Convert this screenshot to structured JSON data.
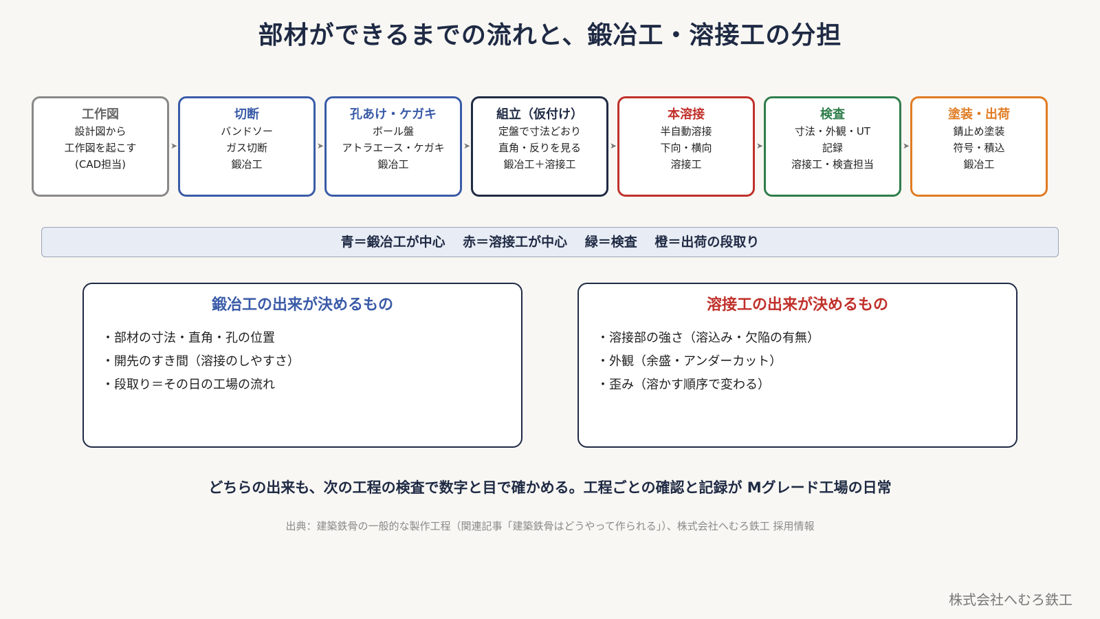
{
  "title": "部材ができるまでの流れと、鍛冶工・溶接工の分担",
  "steps": [
    {
      "title": "工作図",
      "lines": [
        "設計図から",
        "工作図を起こす",
        "(CAD担当)"
      ],
      "color": "#888888",
      "title_color": "#666666"
    },
    {
      "title": "切断",
      "lines": [
        "バンドソー",
        "ガス切断",
        "鍛冶工"
      ],
      "color": "#3a5ba8",
      "title_color": "#3a5ba8"
    },
    {
      "title": "孔あけ・ケガキ",
      "lines": [
        "ボール盤",
        "アトラエース・ケガキ",
        "鍛冶工"
      ],
      "color": "#3a5ba8",
      "title_color": "#3a5ba8"
    },
    {
      "title": "組立（仮付け）",
      "lines": [
        "定盤で寸法どおり",
        "直角・反りを見る",
        "鍛冶工＋溶接工"
      ],
      "color": "#1f2a44",
      "title_color": "#1f2a44"
    },
    {
      "title": "本溶接",
      "lines": [
        "半自動溶接",
        "下向・横向",
        "溶接工"
      ],
      "color": "#c0302a",
      "title_color": "#c0302a"
    },
    {
      "title": "検査",
      "lines": [
        "寸法・外観・UT",
        "記録",
        "溶接工・検査担当"
      ],
      "color": "#2e7d4a",
      "title_color": "#2e7d4a"
    },
    {
      "title": "塗装・出荷",
      "lines": [
        "錆止め塗装",
        "符号・積込",
        "鍛冶工"
      ],
      "color": "#e07b22",
      "title_color": "#e07b22"
    }
  ],
  "legend": "青＝鍛冶工が中心　 赤＝溶接工が中心　 緑＝検査　 橙＝出荷の段取り",
  "panels": [
    {
      "heading": "鍛冶工の出来が決めるもの",
      "color": "#3a5ba8",
      "items": [
        "・部材の寸法・直角・孔の位置",
        "・開先のすき間（溶接のしやすさ）",
        "・段取り＝その日の工場の流れ"
      ]
    },
    {
      "heading": "溶接工の出来が決めるもの",
      "color": "#c0302a",
      "items": [
        "・溶接部の強さ（溶込み・欠陥の有無）",
        "・外観（余盛・アンダーカット）",
        "・歪み（溶かす順序で変わる）"
      ]
    }
  ],
  "summary": "どちらの出来も、次の工程の検査で数字と目で確かめる。工程ごとの確認と記録が Mグレード工場の日常",
  "source": "出典：建築鉄骨の一般的な製作工程（関連記事「建築鉄骨はどうやって作られる」）、株式会社へむろ鉄工 採用情報",
  "footer": "株式会社へむろ鉄工"
}
